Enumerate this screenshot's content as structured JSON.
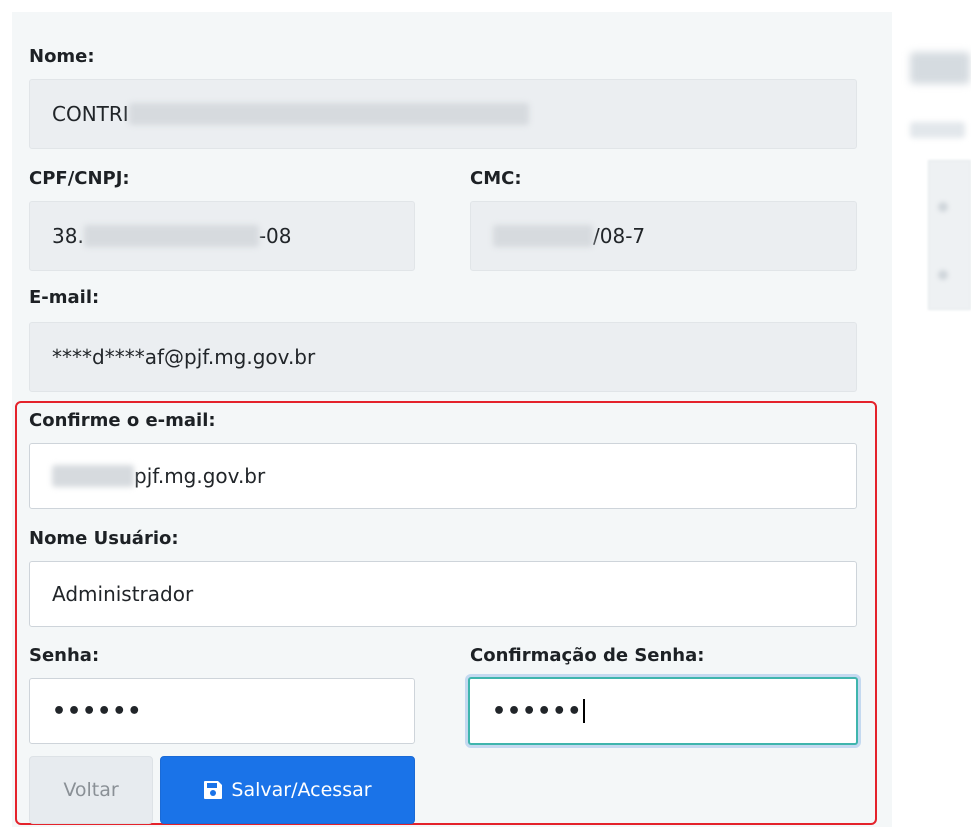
{
  "form": {
    "nome": {
      "label": "Nome:",
      "value_prefix": "CONTRI"
    },
    "cpf_cnpj": {
      "label": "CPF/CNPJ:",
      "value_prefix": "38.",
      "value_suffix": "-08"
    },
    "cmc": {
      "label": "CMC:",
      "value_suffix": "/08-7"
    },
    "email": {
      "label": "E-mail:",
      "value": "****d****af@pjf.mg.gov.br"
    },
    "confirm_email": {
      "label": "Confirme o e-mail:",
      "value_suffix": "pjf.mg.gov.br"
    },
    "nome_usuario": {
      "label": "Nome Usuário:",
      "value": "Administrador"
    },
    "senha": {
      "label": "Senha:",
      "value": "••••••"
    },
    "confirmacao_senha": {
      "label": "Confirmação de Senha:",
      "value": "••••••"
    }
  },
  "buttons": {
    "voltar": "Voltar",
    "salvar": "Salvar/Acessar"
  },
  "icons": {
    "save": "floppy-disk-icon"
  },
  "colors": {
    "highlight_border": "#e4222b",
    "primary_button": "#1a73e8",
    "focus_border": "#3fb5ad"
  }
}
